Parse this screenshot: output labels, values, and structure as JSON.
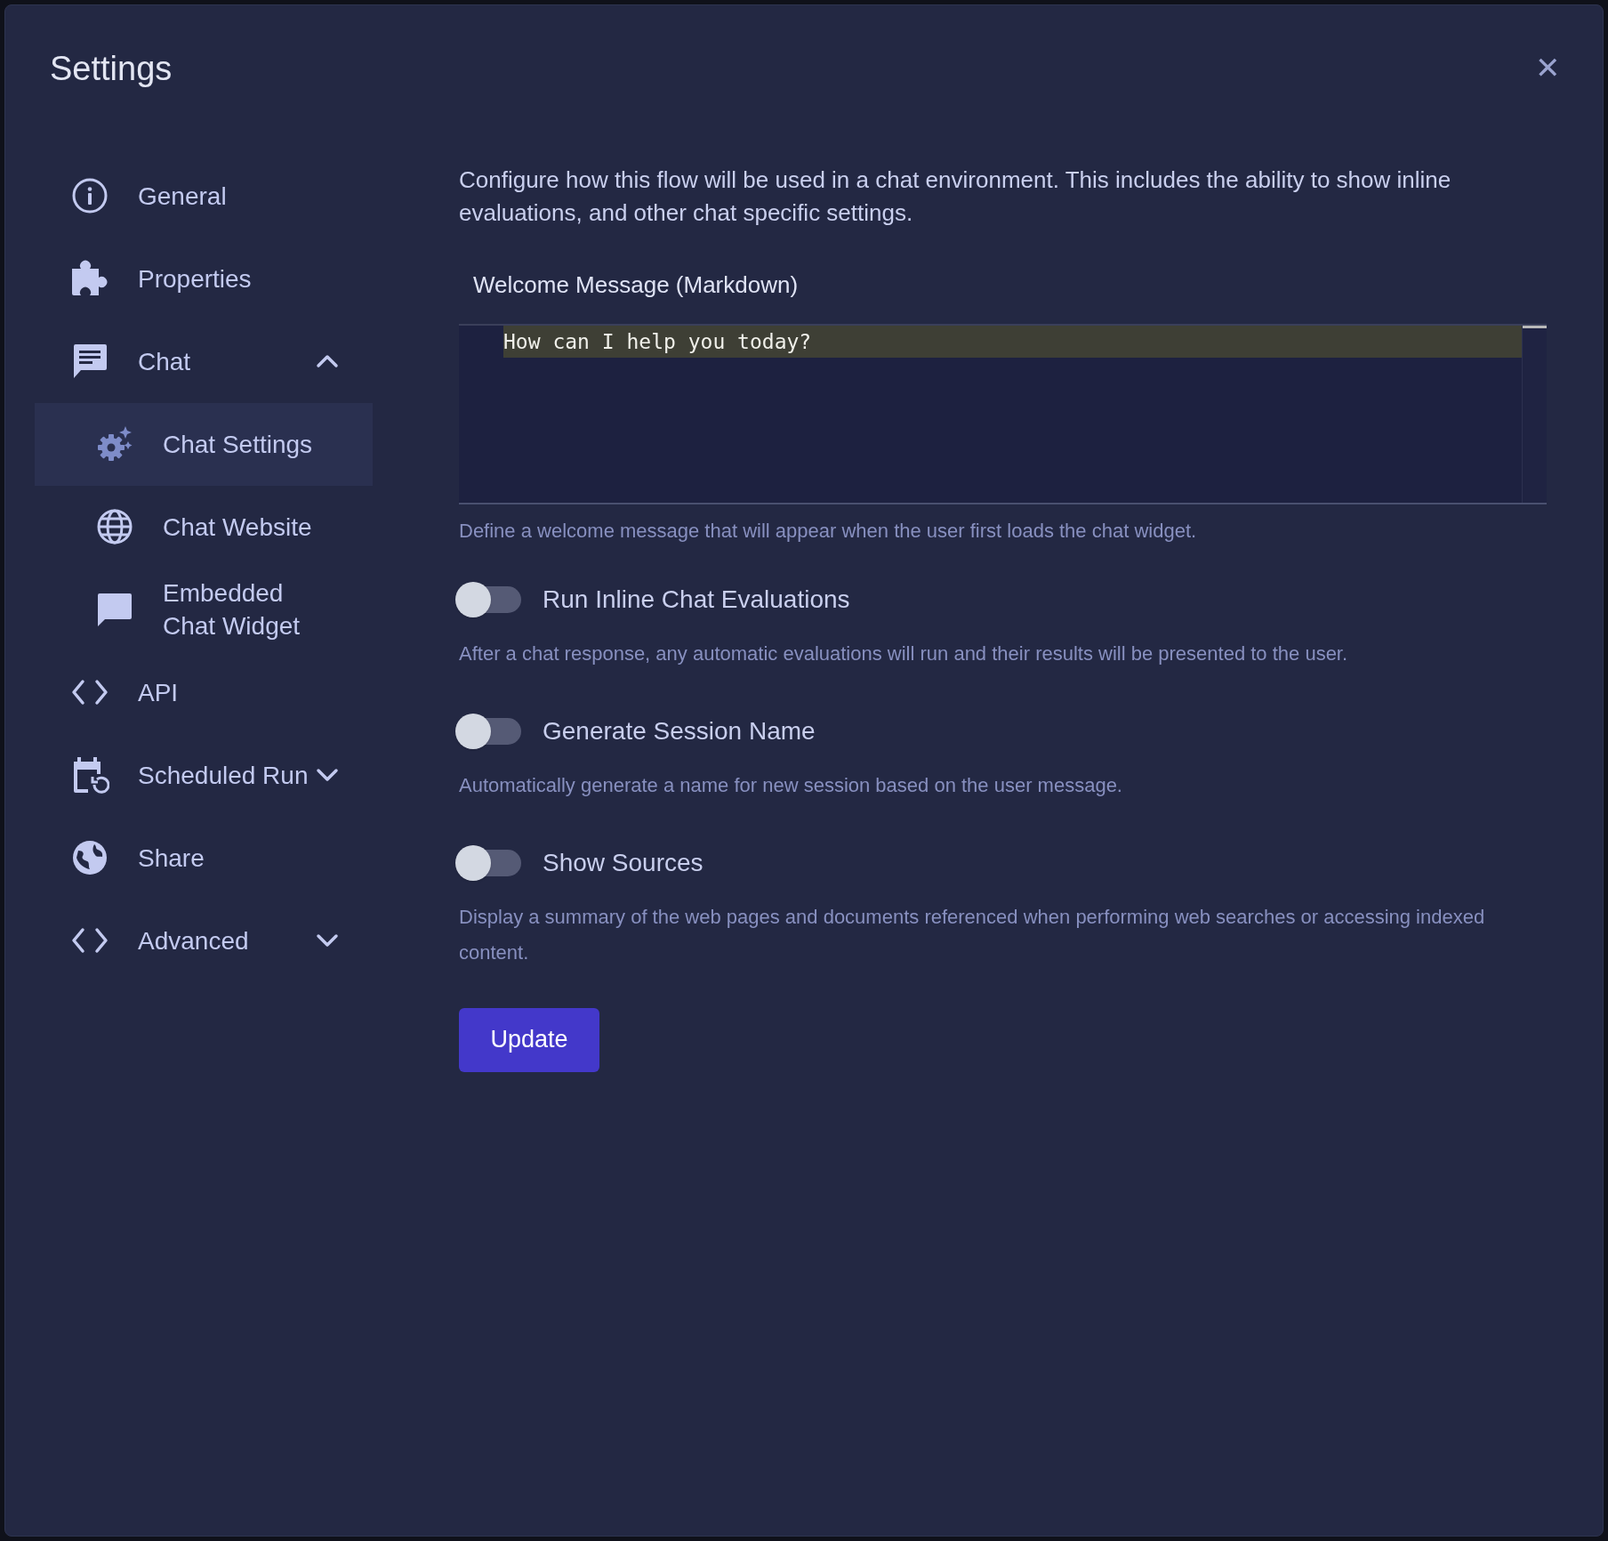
{
  "dialog": {
    "title": "Settings",
    "close": "✕"
  },
  "sidebar": {
    "items": [
      {
        "label": "General",
        "selected": false
      },
      {
        "label": "Properties",
        "selected": false
      },
      {
        "label": "Chat",
        "selected": false,
        "expanded": true,
        "children": [
          {
            "label": "Chat Settings",
            "selected": true
          },
          {
            "label": "Chat Website",
            "selected": false
          },
          {
            "label": "Embedded Chat Widget",
            "selected": false
          }
        ]
      },
      {
        "label": "API",
        "selected": false
      },
      {
        "label": "Scheduled Run",
        "selected": false,
        "expanded": false
      },
      {
        "label": "Share",
        "selected": false
      },
      {
        "label": "Advanced",
        "selected": false,
        "expanded": false
      }
    ]
  },
  "content": {
    "description": "Configure how this flow will be used in a chat environment. This includes the ability to show inline evaluations, and other chat specific settings.",
    "welcome": {
      "label": "Welcome Message (Markdown)",
      "value": "How can I help you today?",
      "help": "Define a welcome message that will appear when the user first loads the chat widget."
    },
    "toggles": [
      {
        "label": "Run Inline Chat Evaluations",
        "on": false,
        "help": "After a chat response, any automatic evaluations will run and their results will be presented to the user."
      },
      {
        "label": "Generate Session Name",
        "on": false,
        "help": "Automatically generate a name for new session based on the user message."
      },
      {
        "label": "Show Sources",
        "on": false,
        "help": "Display a summary of the web pages and documents referenced when performing web searches or accessing indexed content."
      }
    ],
    "button": "Update"
  }
}
